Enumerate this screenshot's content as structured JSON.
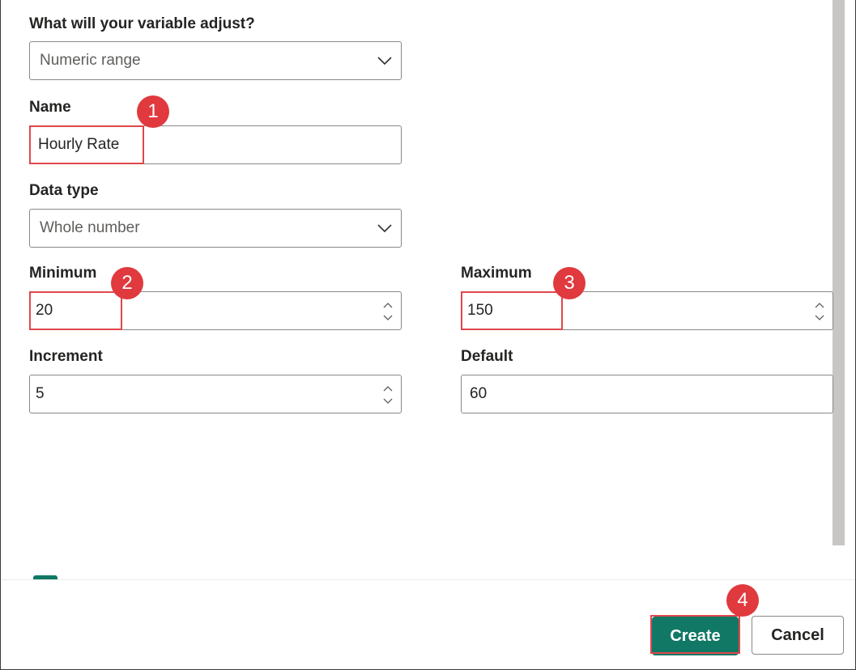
{
  "form": {
    "adjust": {
      "label": "What will your variable adjust?",
      "value": "Numeric range"
    },
    "name": {
      "label": "Name",
      "value": "Hourly Rate"
    },
    "data_type": {
      "label": "Data type",
      "value": "Whole number"
    },
    "minimum": {
      "label": "Minimum",
      "value": "20"
    },
    "maximum": {
      "label": "Maximum",
      "value": "150"
    },
    "increment": {
      "label": "Increment",
      "value": "5"
    },
    "default": {
      "label": "Default",
      "value": "60"
    }
  },
  "annotations": [
    "1",
    "2",
    "3",
    "4"
  ],
  "buttons": {
    "create": "Create",
    "cancel": "Cancel"
  },
  "colors": {
    "accent": "#117865",
    "highlight": "#e0393e"
  },
  "icons": {
    "dropdown": "chevron-down-icon",
    "spinner": "spin-arrows-icon"
  }
}
